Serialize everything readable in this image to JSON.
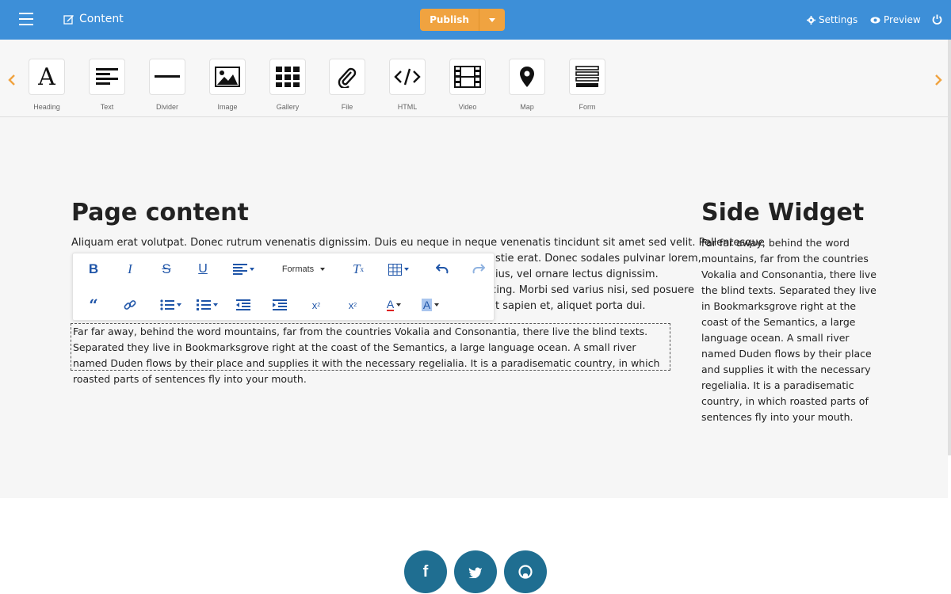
{
  "topbar": {
    "brand_label": "Content",
    "publish_label": "Publish",
    "settings_label": "Settings",
    "preview_label": "Preview"
  },
  "elements": [
    {
      "label": "Heading",
      "icon": "heading-icon"
    },
    {
      "label": "Text",
      "icon": "text-icon"
    },
    {
      "label": "Divider",
      "icon": "divider-icon"
    },
    {
      "label": "Image",
      "icon": "image-icon"
    },
    {
      "label": "Gallery",
      "icon": "gallery-icon"
    },
    {
      "label": "File",
      "icon": "paperclip-icon"
    },
    {
      "label": "HTML",
      "icon": "code-icon"
    },
    {
      "label": "Video",
      "icon": "film-icon"
    },
    {
      "label": "Map",
      "icon": "map-pin-icon"
    },
    {
      "label": "Form",
      "icon": "form-icon"
    }
  ],
  "main": {
    "title": "Page content",
    "para1_line1": "Aliquam erat volutpat. Donec rutrum venenatis dignissim. Duis eu neque in neque venenatis tincidunt sit amet sed velit. Pellentesque",
    "para1_line2_tail": "stie erat. Donec sodales pulvinar lorem,",
    "para1_line3_tail": "ius, vel ornare lectus dignissim.",
    "para1_line4_tail": "la adipiscing. Morbi sed varius nisi, sed posuere",
    "para1_line5_tail": "facilisis ut sapien et, aliquet porta dui.",
    "para2": "Far far away, behind the word mountains, far from the countries Vokalia and Consonantia, there live the blind texts. Separated they live in Bookmarksgrove right at the coast of the Semantics, a large language ocean. A small river named Duden flows by their place and supplies it with the necessary regelialia. It is a paradisematic country, in which roasted parts of sentences fly into your mouth."
  },
  "toolbar": {
    "formats_label": "Formats"
  },
  "side": {
    "title": "Side Widget",
    "text": "Far far away, behind the word mountains, far from the countries Vokalia and Consonantia, there live the blind texts. Separated they live in Bookmarksgrove right at the coast of the Semantics, a large language ocean. A small river named Duden flows by their place and supplies it with the necessary regelialia. It is a paradisematic country, in which roasted parts of sentences fly into your mouth."
  },
  "colors": {
    "topbar": "#3d8fd8",
    "publish": "#f0a340",
    "social": "#1f6e91",
    "toolbar_icon": "#1f55a8"
  }
}
